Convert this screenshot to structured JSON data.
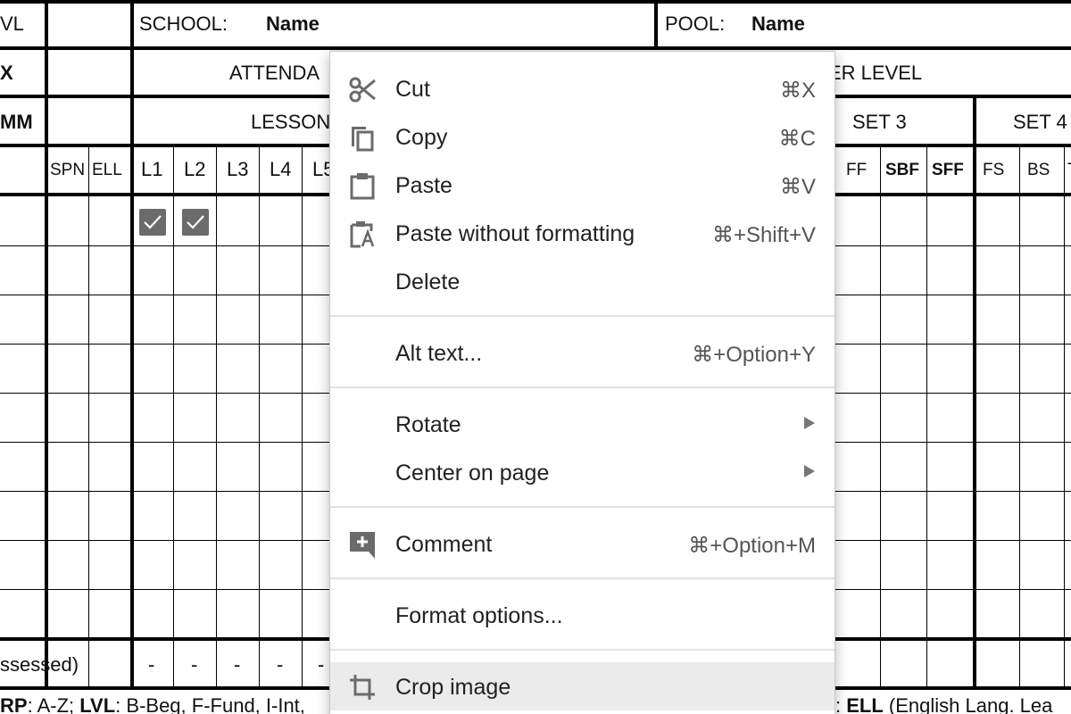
{
  "document": {
    "header_row1": {
      "lvl_label": "VL",
      "school_label": "SCHOOL:",
      "school_value": "Name",
      "pool_label": "POOL:",
      "pool_value": "Name"
    },
    "header_row2": {
      "x_label": "X",
      "attendance_label": "ATTENDA",
      "per_level_label": "ER LEVEL"
    },
    "header_row3": {
      "comm_label": "MM",
      "lessons_label": "LESSON",
      "set3_label": "SET 3",
      "set4_label": "SET 4"
    },
    "columns": {
      "spn": "SPN",
      "ell": "ELL",
      "lessons": [
        "L1",
        "L2",
        "L3",
        "L4",
        "L5"
      ],
      "ff": "FF",
      "sbf": "SBF",
      "sff": "SFF",
      "fs": "FS",
      "bs": "BS",
      "partial": "T"
    },
    "checked_lessons_first_row": [
      "L1",
      "L2"
    ],
    "footer_row": {
      "assessed_label": "ssessed)",
      "dashes": [
        "-",
        "-",
        "-",
        "-",
        "-"
      ]
    },
    "legend": {
      "grp_label": "RP",
      "grp_text": ": A-Z; ",
      "lvl_label": "LVL",
      "lvl_text": ": B-Beg, F-Fund, I-Int,",
      "ell_pre": ": ",
      "ell_label": "ELL",
      "ell_text": " (English Lang. Lea"
    }
  },
  "context_menu": {
    "items": [
      {
        "label": "Cut",
        "shortcut": "⌘X",
        "icon": "scissors-icon"
      },
      {
        "label": "Copy",
        "shortcut": "⌘C",
        "icon": "copy-icon"
      },
      {
        "label": "Paste",
        "shortcut": "⌘V",
        "icon": "clipboard-icon"
      },
      {
        "label": "Paste without formatting",
        "shortcut": "⌘+Shift+V",
        "icon": "paste-plain-icon"
      },
      {
        "label": "Delete",
        "shortcut": ""
      },
      {
        "label": "Alt text...",
        "shortcut": "⌘+Option+Y"
      },
      {
        "label": "Rotate",
        "submenu": true
      },
      {
        "label": "Center on page",
        "submenu": true
      },
      {
        "label": "Comment",
        "shortcut": "⌘+Option+M",
        "icon": "add-comment-icon"
      },
      {
        "label": "Format options..."
      },
      {
        "label": "Crop image",
        "icon": "crop-icon",
        "highlighted": true
      }
    ]
  },
  "colors": {
    "menu_highlight": "#ebebeb",
    "icon_gray": "#6b6b6b",
    "shortcut_gray": "#555555",
    "grid_black": "#000000"
  }
}
